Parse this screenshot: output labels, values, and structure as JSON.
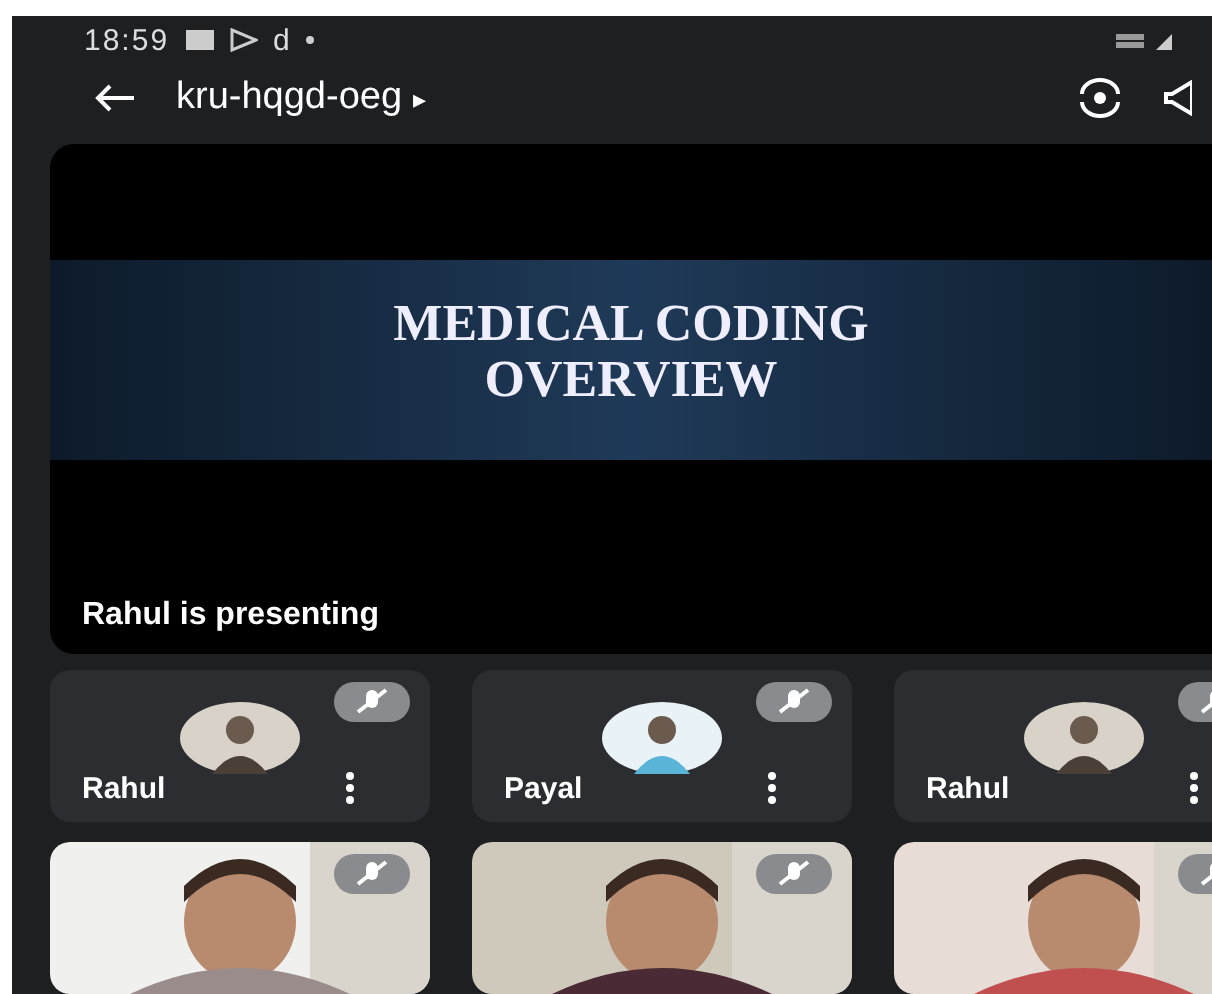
{
  "status_bar": {
    "time": "18:59",
    "notification_letter": "d"
  },
  "toolbar": {
    "meeting_code": "kru-hqgd-oeg",
    "caret": "▸"
  },
  "presentation": {
    "slide_title": "MEDICAL CODING OVERVIEW",
    "caption": "Rahul is presenting"
  },
  "participants": [
    {
      "name": "Rahul",
      "kind": "avatar",
      "muted": true
    },
    {
      "name": "Payal",
      "kind": "avatar",
      "muted": true
    },
    {
      "name": "Rahul",
      "kind": "avatar",
      "muted": true
    },
    {
      "kind": "video",
      "muted": true
    },
    {
      "kind": "video",
      "muted": true
    },
    {
      "kind": "video",
      "muted": true
    }
  ]
}
